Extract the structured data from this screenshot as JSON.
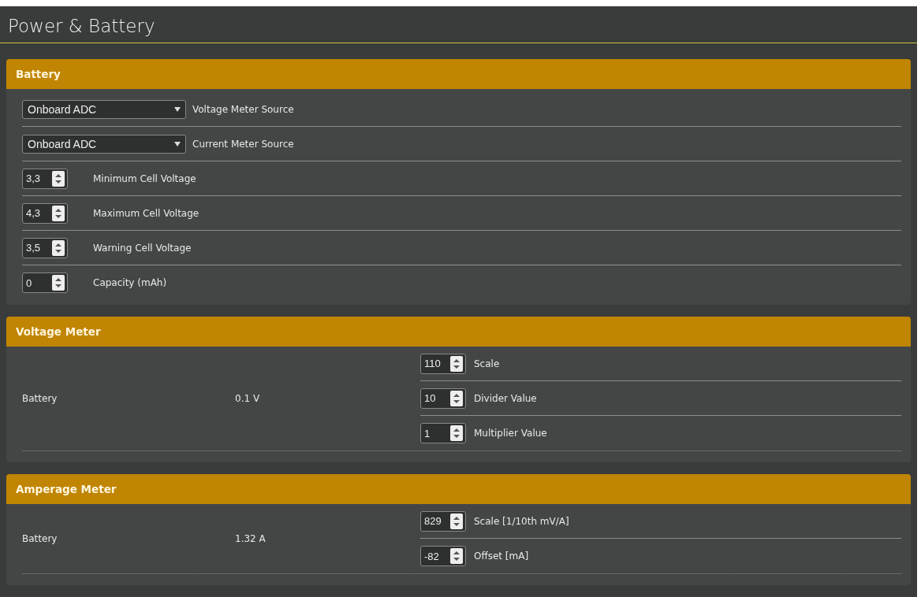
{
  "title": "Power & Battery",
  "sections": [
    {
      "kind": "settings",
      "title": "Battery",
      "rows": [
        {
          "kind": "select",
          "value": "Onboard ADC",
          "label": "Voltage Meter Source"
        },
        {
          "kind": "select",
          "value": "Onboard ADC",
          "label": "Current Meter Source"
        },
        {
          "kind": "number",
          "value": "3,3",
          "label": "Minimum Cell Voltage"
        },
        {
          "kind": "number",
          "value": "4,3",
          "label": "Maximum Cell Voltage"
        },
        {
          "kind": "number",
          "value": "3,5",
          "label": "Warning Cell Voltage"
        },
        {
          "kind": "number",
          "value": "0",
          "label": "Capacity (mAh)"
        }
      ]
    },
    {
      "kind": "meter",
      "title": "Voltage Meter",
      "meters": [
        {
          "name": "Battery",
          "reading": "0.1 V",
          "settings": [
            {
              "value": "110",
              "label": "Scale"
            },
            {
              "value": "10",
              "label": "Divider Value"
            },
            {
              "value": "1",
              "label": "Multiplier Value"
            }
          ]
        }
      ]
    },
    {
      "kind": "meter",
      "title": "Amperage Meter",
      "meters": [
        {
          "name": "Battery",
          "reading": "1.32 A",
          "settings": [
            {
              "value": "829",
              "label": "Scale [1/10th mV/A]"
            },
            {
              "value": "-82",
              "label": "Offset [mA]"
            }
          ]
        }
      ]
    }
  ]
}
